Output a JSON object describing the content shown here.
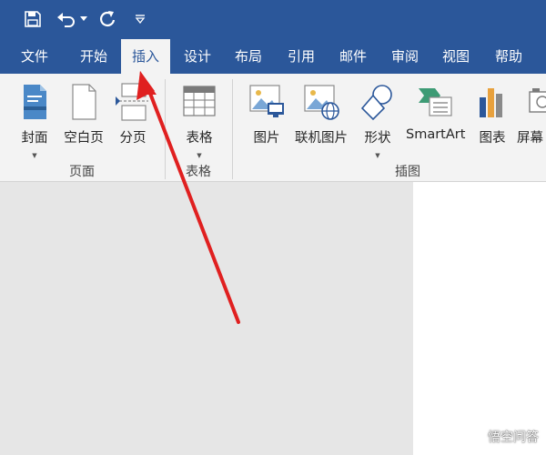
{
  "colors": {
    "brand": "#2b579a",
    "ribbon_bg": "#f3f3f3",
    "doc_bg": "#e6e6e6",
    "arrow": "#e02020"
  },
  "quick_access": {
    "save_icon": "save-icon",
    "undo_icon": "undo-icon",
    "undo_dropdown_icon": "chevron-down-icon",
    "redo_icon": "redo-icon",
    "customize_icon": "customize-quick-access-icon"
  },
  "tabs": [
    {
      "id": "file",
      "label": "文件"
    },
    {
      "id": "home",
      "label": "开始"
    },
    {
      "id": "insert",
      "label": "插入",
      "active": true
    },
    {
      "id": "design",
      "label": "设计"
    },
    {
      "id": "layout",
      "label": "布局"
    },
    {
      "id": "references",
      "label": "引用"
    },
    {
      "id": "mailings",
      "label": "邮件"
    },
    {
      "id": "review",
      "label": "审阅"
    },
    {
      "id": "view",
      "label": "视图"
    },
    {
      "id": "help",
      "label": "帮助"
    }
  ],
  "ribbon": {
    "groups": {
      "pages": "页面",
      "tables": "表格",
      "illustrations": "插图"
    },
    "buttons": {
      "cover": "封面",
      "blank_page": "空白页",
      "page_break": "分页",
      "table": "表格",
      "pictures": "图片",
      "online_pictures": "联机图片",
      "shapes": "形状",
      "smartart": "SmartArt",
      "chart": "图表",
      "screenshot": "屏幕"
    }
  },
  "watermark": {
    "text": "悟空问答"
  }
}
